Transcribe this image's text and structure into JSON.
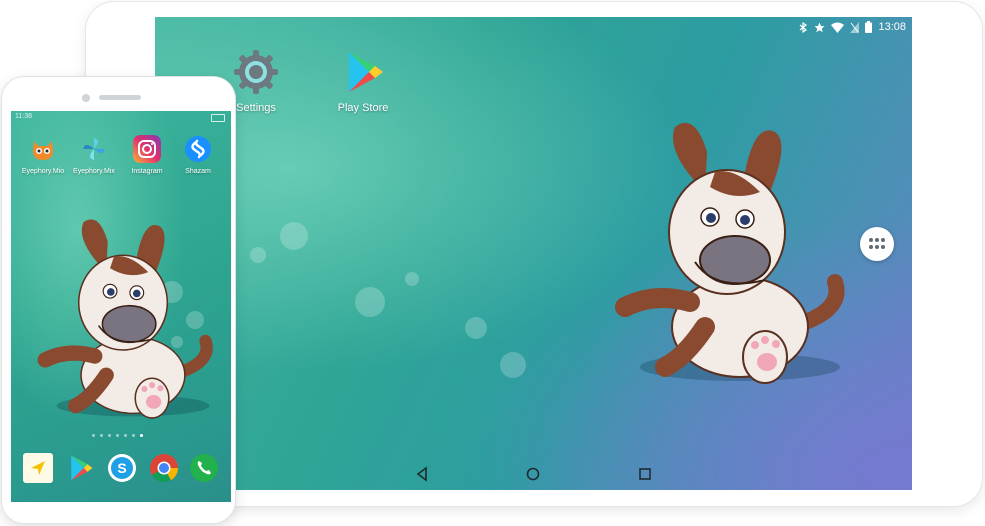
{
  "tablet": {
    "status_time": "13:08",
    "status_icons": [
      "bluetooth-icon",
      "star-icon",
      "wifi-icon",
      "no-sim-icon",
      "battery-icon"
    ],
    "apps": [
      {
        "label": "Settings",
        "icon": "gear-icon"
      },
      {
        "label": "Play Store",
        "icon": "play-store-icon"
      }
    ],
    "nav": [
      "back-icon",
      "home-icon",
      "recents-icon"
    ],
    "app_drawer_icon": "app-drawer-icon"
  },
  "phone": {
    "status_time": "11:38",
    "apps": [
      {
        "label": "Eyephory.Mio",
        "icon": "cat-icon"
      },
      {
        "label": "Eyephory.Mix",
        "icon": "pinwheel-icon"
      },
      {
        "label": "Instagram",
        "icon": "instagram-icon"
      },
      {
        "label": "Shazam",
        "icon": "shazam-icon"
      }
    ],
    "page_dots": 7,
    "active_dot": 6,
    "dock": [
      "navigation-arrow-icon",
      "play-store-icon",
      "skype-icon",
      "chrome-icon",
      "phone-icon"
    ]
  },
  "colors": {
    "wallpaper_teal": "#2fa596",
    "wallpaper_purple": "#6b7fc6",
    "dog_body": "#f3ece6",
    "dog_ears": "#8a4a30"
  }
}
